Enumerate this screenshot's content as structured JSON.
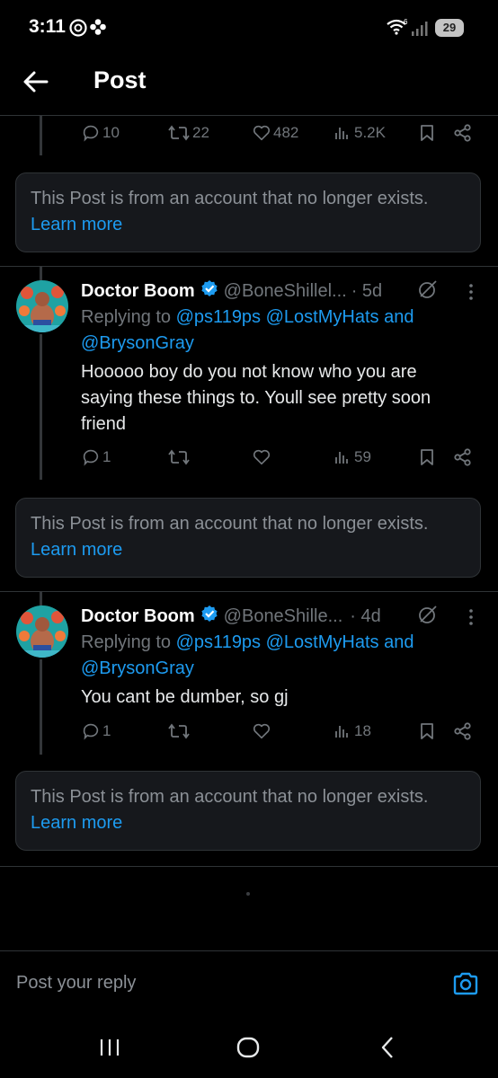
{
  "status": {
    "time": "3:11",
    "battery": "29"
  },
  "header": {
    "title": "Post"
  },
  "top_actions": {
    "replies": "10",
    "reposts": "22",
    "likes": "482",
    "views": "5.2K"
  },
  "notices": [
    {
      "text": "This Post is from an account that no longer exists.",
      "link": "Learn more"
    },
    {
      "text": "This Post is from an account that no longer exists.",
      "link": "Learn more"
    },
    {
      "text": "This Post is from an account that no longer exists.",
      "link": "Learn more"
    }
  ],
  "posts": [
    {
      "name": "Doctor Boom",
      "handle": "@BoneShillel...",
      "time": "· 5d",
      "replying_prefix": "Replying to",
      "mention1": "@ps119ps",
      "mention2": "@LostMyHats",
      "and": "and",
      "mention3": "@BrysonGray",
      "text_line1": "Hooooo boy do you not know who you are",
      "text_line2": "saying these things to.  Youll see pretty soon",
      "text_line3": "friend",
      "replies": "1",
      "views": "59"
    },
    {
      "name": "Doctor Boom",
      "handle": "@BoneShille...",
      "time": "· 4d",
      "replying_prefix": "Replying to",
      "mention1": "@ps119ps",
      "mention2": "@LostMyHats",
      "and": "and",
      "mention3": "@BrysonGray",
      "text_line1": "You cant be dumber, so gj",
      "replies": "1",
      "views": "18"
    }
  ],
  "reply_bar": {
    "placeholder": "Post your reply"
  },
  "colors": {
    "accent": "#1d9bf0",
    "background": "#000000",
    "muted": "#71767b",
    "card": "#16181c"
  }
}
